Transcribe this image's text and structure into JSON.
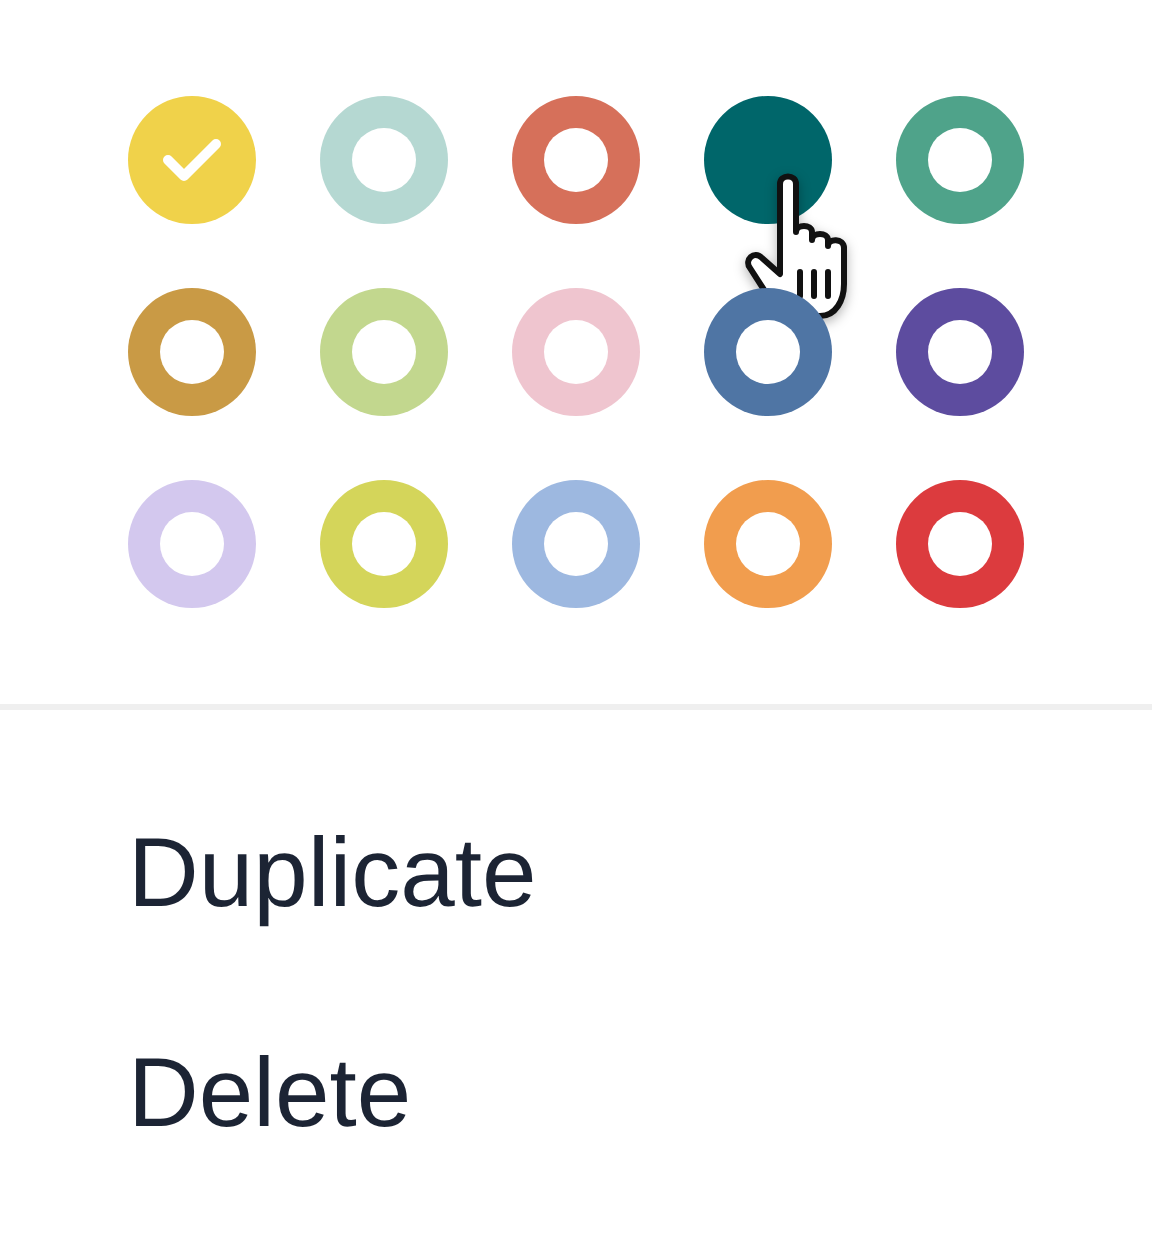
{
  "swatches": [
    {
      "color": "#f0d24a",
      "selected": true,
      "hovered": false
    },
    {
      "color": "#b5d8d2",
      "selected": false,
      "hovered": false
    },
    {
      "color": "#d6705a",
      "selected": false,
      "hovered": false
    },
    {
      "color": "#00666a",
      "selected": false,
      "hovered": true
    },
    {
      "color": "#4fa38a",
      "selected": false,
      "hovered": false
    },
    {
      "color": "#c99a45",
      "selected": false,
      "hovered": false
    },
    {
      "color": "#c2d78e",
      "selected": false,
      "hovered": false
    },
    {
      "color": "#efc5cf",
      "selected": false,
      "hovered": false
    },
    {
      "color": "#4f75a4",
      "selected": false,
      "hovered": false
    },
    {
      "color": "#5d4c9f",
      "selected": false,
      "hovered": false
    },
    {
      "color": "#d3c8ee",
      "selected": false,
      "hovered": false
    },
    {
      "color": "#d4d55a",
      "selected": false,
      "hovered": false
    },
    {
      "color": "#9db8e0",
      "selected": false,
      "hovered": false
    },
    {
      "color": "#f19d4e",
      "selected": false,
      "hovered": false
    },
    {
      "color": "#dc3b3e",
      "selected": false,
      "hovered": false
    }
  ],
  "menu": [
    {
      "label": "Duplicate"
    },
    {
      "label": "Delete"
    }
  ]
}
